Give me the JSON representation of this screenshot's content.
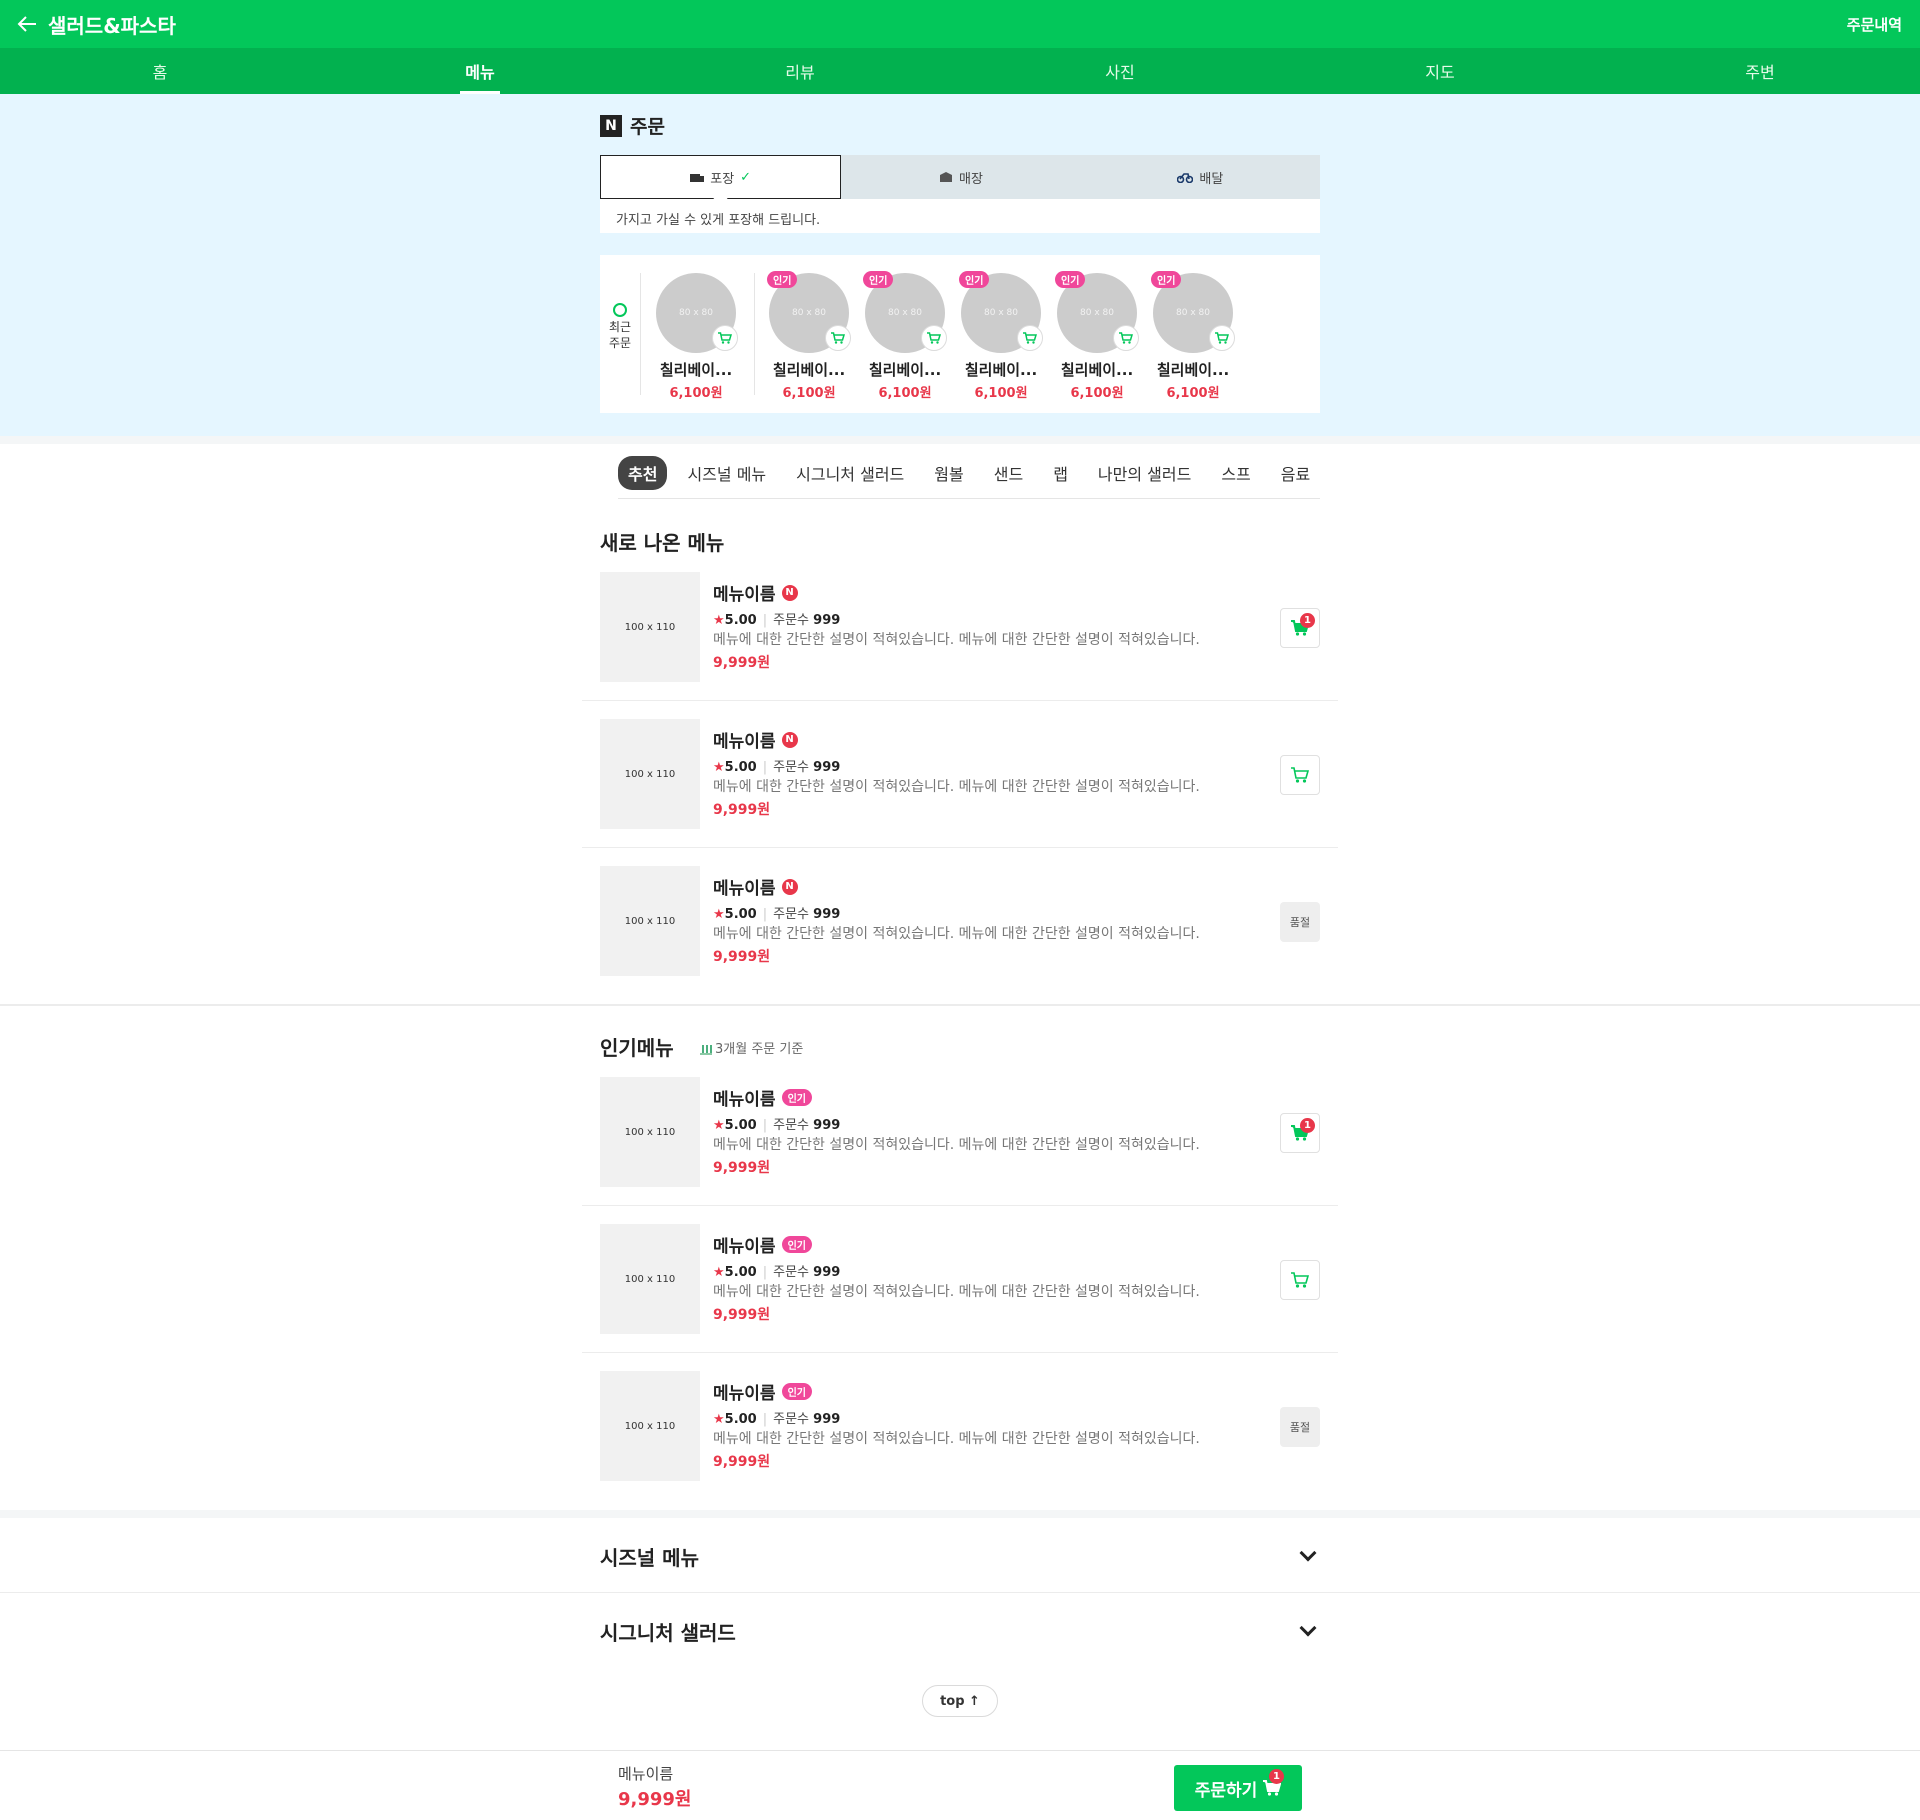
{
  "header": {
    "title": "샐러드&파스타",
    "order_history": "주문내역",
    "tabs": [
      "홈",
      "메뉴",
      "리뷰",
      "사진",
      "지도",
      "주변"
    ]
  },
  "order": {
    "heading": "주문",
    "logo_letter": "N",
    "methods": [
      {
        "label": "포장",
        "icon": "takeout-icon",
        "active": true
      },
      {
        "label": "매장",
        "icon": "store-icon",
        "active": false
      },
      {
        "label": "배달",
        "icon": "delivery-icon",
        "active": false
      }
    ],
    "method_desc": "가지고 가실 수 있게 포장해 드립니다.",
    "recent_label": "최근 주문",
    "recent_items": [
      {
        "thumb": "80 x 80",
        "name": "칠리베이...",
        "price": "6,100원",
        "popular": false
      },
      {
        "thumb": "80 x 80",
        "name": "칠리베이...",
        "price": "6,100원",
        "popular": true
      },
      {
        "thumb": "80 x 80",
        "name": "칠리베이...",
        "price": "6,100원",
        "popular": true
      },
      {
        "thumb": "80 x 80",
        "name": "칠리베이...",
        "price": "6,100원",
        "popular": true
      },
      {
        "thumb": "80 x 80",
        "name": "칠리베이...",
        "price": "6,100원",
        "popular": true
      },
      {
        "thumb": "80 x 80",
        "name": "칠리베이...",
        "price": "6,100원",
        "popular": true
      }
    ],
    "popular_badge": "인기"
  },
  "categories": [
    "추천",
    "시즈널 메뉴",
    "시그니처 샐러드",
    "웜볼",
    "샌드",
    "랩",
    "나만의 샐러드",
    "스프",
    "음료"
  ],
  "new_menu": {
    "title": "새로 나온 메뉴",
    "items": [
      {
        "thumb": "100 x 110",
        "name": "메뉴이름",
        "badge": "N",
        "rating": "5.00",
        "orders_label": "주문수",
        "orders": "999",
        "desc": "메뉴에 대한 간단한 설명이 적혀있습니다. 메뉴에 대한 간단한 설명이 적혀있습니다.",
        "price": "9,999원",
        "state": "in_cart",
        "cart_count": "1"
      },
      {
        "thumb": "100 x 110",
        "name": "메뉴이름",
        "badge": "N",
        "rating": "5.00",
        "orders_label": "주문수",
        "orders": "999",
        "desc": "메뉴에 대한 간단한 설명이 적혀있습니다. 메뉴에 대한 간단한 설명이 적혀있습니다.",
        "price": "9,999원",
        "state": "cart"
      },
      {
        "thumb": "100 x 110",
        "name": "메뉴이름",
        "badge": "N",
        "rating": "5.00",
        "orders_label": "주문수",
        "orders": "999",
        "desc": "메뉴에 대한 간단한 설명이 적혀있습니다. 메뉴에 대한 간단한 설명이 적혀있습니다.",
        "price": "9,999원",
        "state": "soldout",
        "soldout_label": "품절"
      }
    ]
  },
  "popular_menu": {
    "title": "인기메뉴",
    "subtitle": "3개월 주문 기준",
    "items": [
      {
        "thumb": "100 x 110",
        "name": "메뉴이름",
        "badge": "인기",
        "rating": "5.00",
        "orders_label": "주문수",
        "orders": "999",
        "desc": "메뉴에 대한 간단한 설명이 적혀있습니다. 메뉴에 대한 간단한 설명이 적혀있습니다.",
        "price": "9,999원",
        "state": "in_cart",
        "cart_count": "1"
      },
      {
        "thumb": "100 x 110",
        "name": "메뉴이름",
        "badge": "인기",
        "rating": "5.00",
        "orders_label": "주문수",
        "orders": "999",
        "desc": "메뉴에 대한 간단한 설명이 적혀있습니다. 메뉴에 대한 간단한 설명이 적혀있습니다.",
        "price": "9,999원",
        "state": "cart"
      },
      {
        "thumb": "100 x 110",
        "name": "메뉴이름",
        "badge": "인기",
        "rating": "5.00",
        "orders_label": "주문수",
        "orders": "999",
        "desc": "메뉴에 대한 간단한 설명이 적혀있습니다. 메뉴에 대한 간단한 설명이 적혀있습니다.",
        "price": "9,999원",
        "state": "soldout",
        "soldout_label": "품절"
      }
    ]
  },
  "accordions": [
    "시즈널 메뉴",
    "시그니처 샐러드"
  ],
  "top_button": "top ↑",
  "bottom": {
    "name": "메뉴이름",
    "price": "9,999원",
    "order_button": "주문하기",
    "cart_count": "1"
  },
  "colors": {
    "brand": "#03c75a",
    "brand_dark": "#02b14f",
    "accent_red": "#e8374a",
    "popular_pink": "#f0479a",
    "section_bg": "#e5f6ff"
  }
}
